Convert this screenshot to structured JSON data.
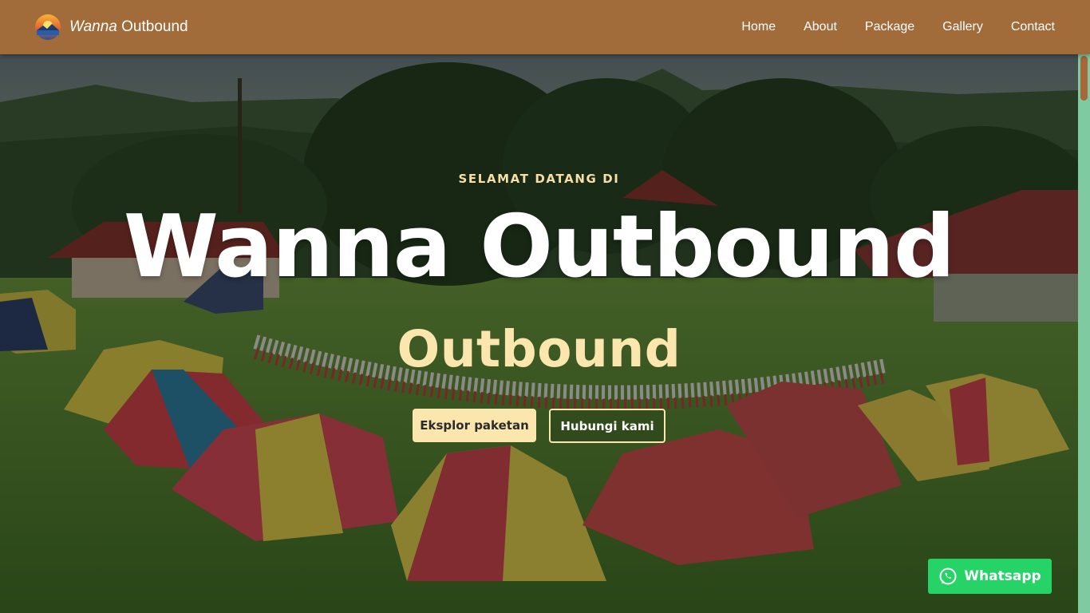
{
  "navbar": {
    "brand_italic": "Wanna",
    "brand_rest": "Outbound",
    "logo_icon": "sunset-logo-icon",
    "links": [
      "Home",
      "About",
      "Package",
      "Gallery",
      "Contact"
    ],
    "background": "#a26c3a"
  },
  "hero": {
    "subtitle": "SELAMAT DATANG DI",
    "title": "Wanna Outbound",
    "subtitle2": "Outbound",
    "primary_button": "Eksplor paketan",
    "secondary_button": "Hubungi kami",
    "accent_color": "#fbe6ad"
  },
  "whatsapp": {
    "label": "Whatsapp",
    "icon": "whatsapp-icon",
    "color": "#25d366"
  }
}
